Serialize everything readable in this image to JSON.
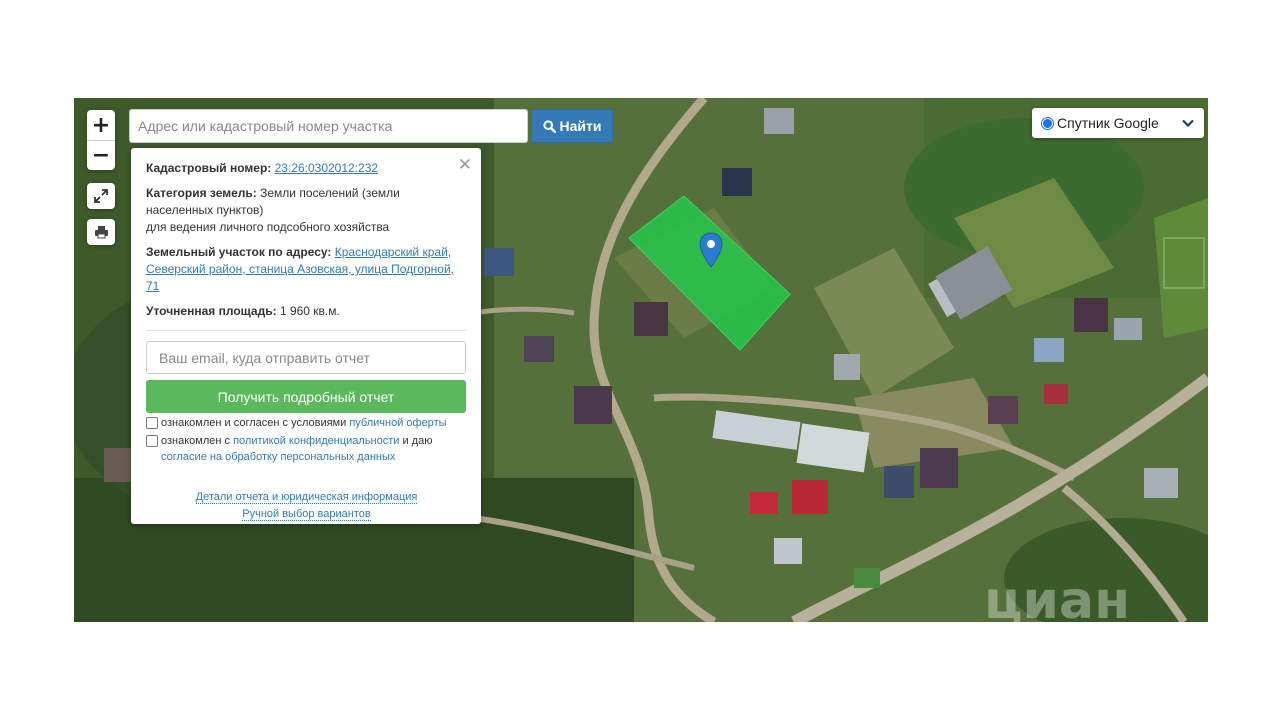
{
  "controls": {
    "zoom_in": "+",
    "zoom_out": "−",
    "fullscreen_icon": "expand-icon",
    "print_icon": "printer-icon"
  },
  "search": {
    "placeholder": "Адрес или кадастровый номер участка",
    "value": "",
    "button_label": "Найти",
    "button_icon": "search-icon"
  },
  "layer": {
    "selected": "Спутник Google"
  },
  "panel": {
    "cadastral_label": "Кадастровый номер:",
    "cadastral_number": "23:26:0302012:232",
    "category_label": "Категория земель:",
    "category_value_1": "Земли поселений (земли населенных пунктов)",
    "category_value_2": "для ведения личного подсобного хозяйства",
    "address_label": "Земельный участок по адресу:",
    "address_value": "Краснодарский край, Северский район, станица Азовская, улица Подгорной, 71",
    "area_label": "Уточненная площадь:",
    "area_value": "1 960 кв.м.",
    "email_placeholder": "Ваш email, куда отправить отчет",
    "report_button": "Получить подробный отчет",
    "consent1_text": "ознакомлен и согласен с условиями",
    "consent1_link": "публичной оферты",
    "consent2_text": "ознакомлен с",
    "consent2_link": "политикой конфиденциальности",
    "consent2_text2": "и даю",
    "consent2_link2": "согласие на обработку персональных данных",
    "details_link": "Детали отчета и юридическая информация",
    "manual_link": "Ручной выбор вариантов"
  },
  "watermark": "циан",
  "colors": {
    "accent": "#337ab7",
    "green_button": "#5cb85c",
    "parcel": "#22c94a",
    "marker": "#2b7bd0"
  }
}
